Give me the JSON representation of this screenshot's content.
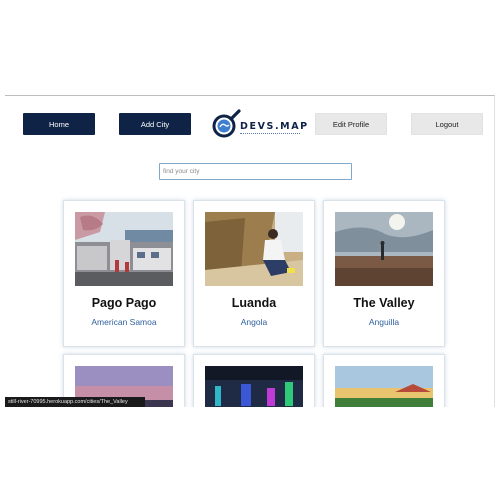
{
  "nav": {
    "home_label": "Home",
    "add_city_label": "Add City",
    "edit_profile_label": "Edit Profile",
    "logout_label": "Logout"
  },
  "logo": {
    "text": "DEVS.MAP"
  },
  "search": {
    "placeholder": "find your city"
  },
  "cities": [
    {
      "city": "Pago Pago",
      "country": "American Samoa"
    },
    {
      "city": "Luanda",
      "country": "Angola"
    },
    {
      "city": "The Valley",
      "country": "Anguilla"
    }
  ],
  "status_bar": {
    "url": "still-river-70995.herokuapp.com/cities/The_Valley"
  },
  "colors": {
    "nav_dark": "#0f2347",
    "nav_light": "#e8e8e8",
    "country_text": "#2f5f9e"
  }
}
